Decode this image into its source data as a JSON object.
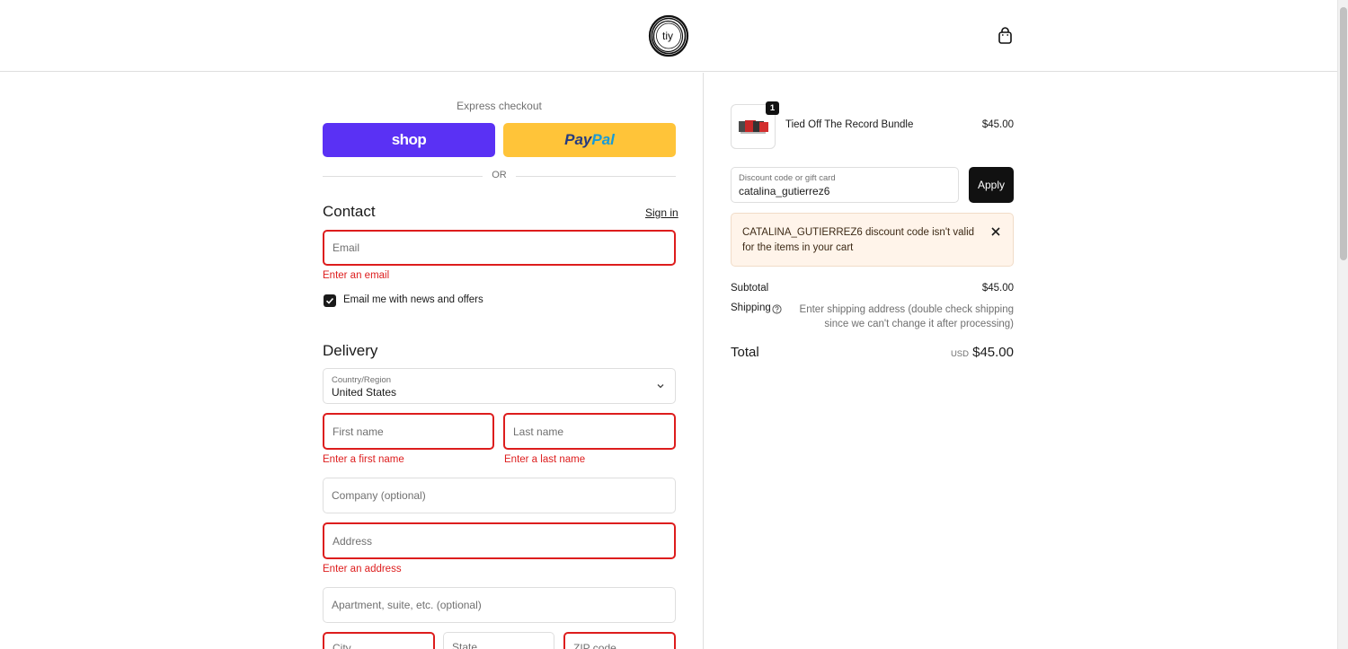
{
  "header": {
    "logo_text": "tiy",
    "cart_icon": "shopping-bag-icon"
  },
  "express": {
    "title": "Express checkout",
    "shop_label": "shop",
    "paypal_pay": "Pay",
    "paypal_pal": "Pal",
    "or_text": "OR"
  },
  "contact": {
    "heading": "Contact",
    "sign_in": "Sign in",
    "email_placeholder": "Email",
    "email_error": "Enter an email",
    "newsletter_label": "Email me with news and offers",
    "newsletter_checked": true
  },
  "delivery": {
    "heading": "Delivery",
    "country_label": "Country/Region",
    "country_value": "United States",
    "first_name_placeholder": "First name",
    "first_name_error": "Enter a first name",
    "last_name_placeholder": "Last name",
    "last_name_error": "Enter a last name",
    "company_placeholder": "Company (optional)",
    "address_placeholder": "Address",
    "address_error": "Enter an address",
    "apartment_placeholder": "Apartment, suite, etc. (optional)",
    "city_placeholder": "City",
    "state_placeholder": "State",
    "zip_placeholder": "ZIP code"
  },
  "order": {
    "product_name": "Tied Off The Record Bundle",
    "product_price": "$45.00",
    "product_qty": "1",
    "discount_label": "Discount code or gift card",
    "discount_value": "catalina_gutierrez6",
    "apply_label": "Apply",
    "alert_text": "CATALINA_GUTIERREZ6 discount code isn't valid for the items in your cart",
    "subtotal_label": "Subtotal",
    "subtotal_value": "$45.00",
    "shipping_label": "Shipping",
    "shipping_note": "Enter shipping address (double check shipping since we can't change it after processing)",
    "total_label": "Total",
    "total_currency": "USD",
    "total_value": "$45.00"
  },
  "colors": {
    "shop": "#5a31f4",
    "paypal": "#ffc439",
    "error": "#dd1d1d",
    "alert_bg": "#fff4ea"
  }
}
